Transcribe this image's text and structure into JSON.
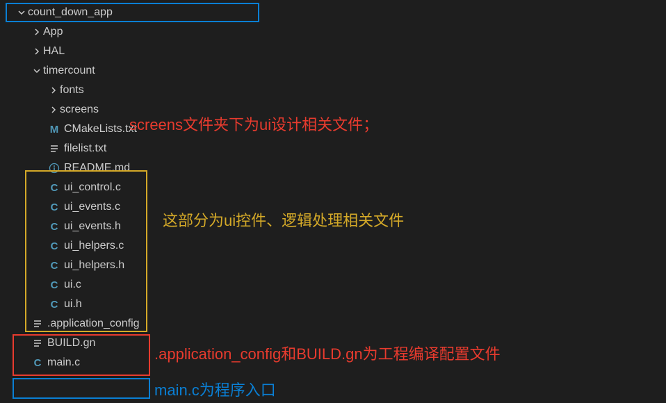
{
  "tree": {
    "root": "count_down_app",
    "children": [
      {
        "type": "folder",
        "name": "App",
        "expanded": false,
        "indent": 1
      },
      {
        "type": "folder",
        "name": "HAL",
        "expanded": false,
        "indent": 1
      },
      {
        "type": "folder",
        "name": "timercount",
        "expanded": true,
        "indent": 1
      },
      {
        "type": "folder",
        "name": "fonts",
        "expanded": false,
        "indent": 2
      },
      {
        "type": "folder",
        "name": "screens",
        "expanded": false,
        "indent": 2
      },
      {
        "type": "file",
        "name": "CMakeLists.txt",
        "icon": "M",
        "indent": 2
      },
      {
        "type": "file",
        "name": "filelist.txt",
        "icon": "lines",
        "indent": 2
      },
      {
        "type": "file",
        "name": "README.md",
        "icon": "info",
        "indent": 2
      },
      {
        "type": "file",
        "name": "ui_control.c",
        "icon": "C",
        "indent": 2
      },
      {
        "type": "file",
        "name": "ui_events.c",
        "icon": "C",
        "indent": 2
      },
      {
        "type": "file",
        "name": "ui_events.h",
        "icon": "C",
        "indent": 2
      },
      {
        "type": "file",
        "name": "ui_helpers.c",
        "icon": "C",
        "indent": 2
      },
      {
        "type": "file",
        "name": "ui_helpers.h",
        "icon": "C",
        "indent": 2
      },
      {
        "type": "file",
        "name": "ui.c",
        "icon": "C",
        "indent": 2
      },
      {
        "type": "file",
        "name": "ui.h",
        "icon": "C",
        "indent": 2
      },
      {
        "type": "file",
        "name": ".application_config",
        "icon": "lines",
        "indent": 1
      },
      {
        "type": "file",
        "name": "BUILD.gn",
        "icon": "lines",
        "indent": 1
      },
      {
        "type": "file",
        "name": "main.c",
        "icon": "C",
        "indent": 1
      }
    ]
  },
  "annotations": {
    "screens": "screens文件夹下为ui设计相关文件；",
    "ui_group": "这部分为ui控件、逻辑处理相关文件",
    "build": ".application_config和BUILD.gn为工程编译配置文件",
    "main": "main.c为程序入口"
  }
}
